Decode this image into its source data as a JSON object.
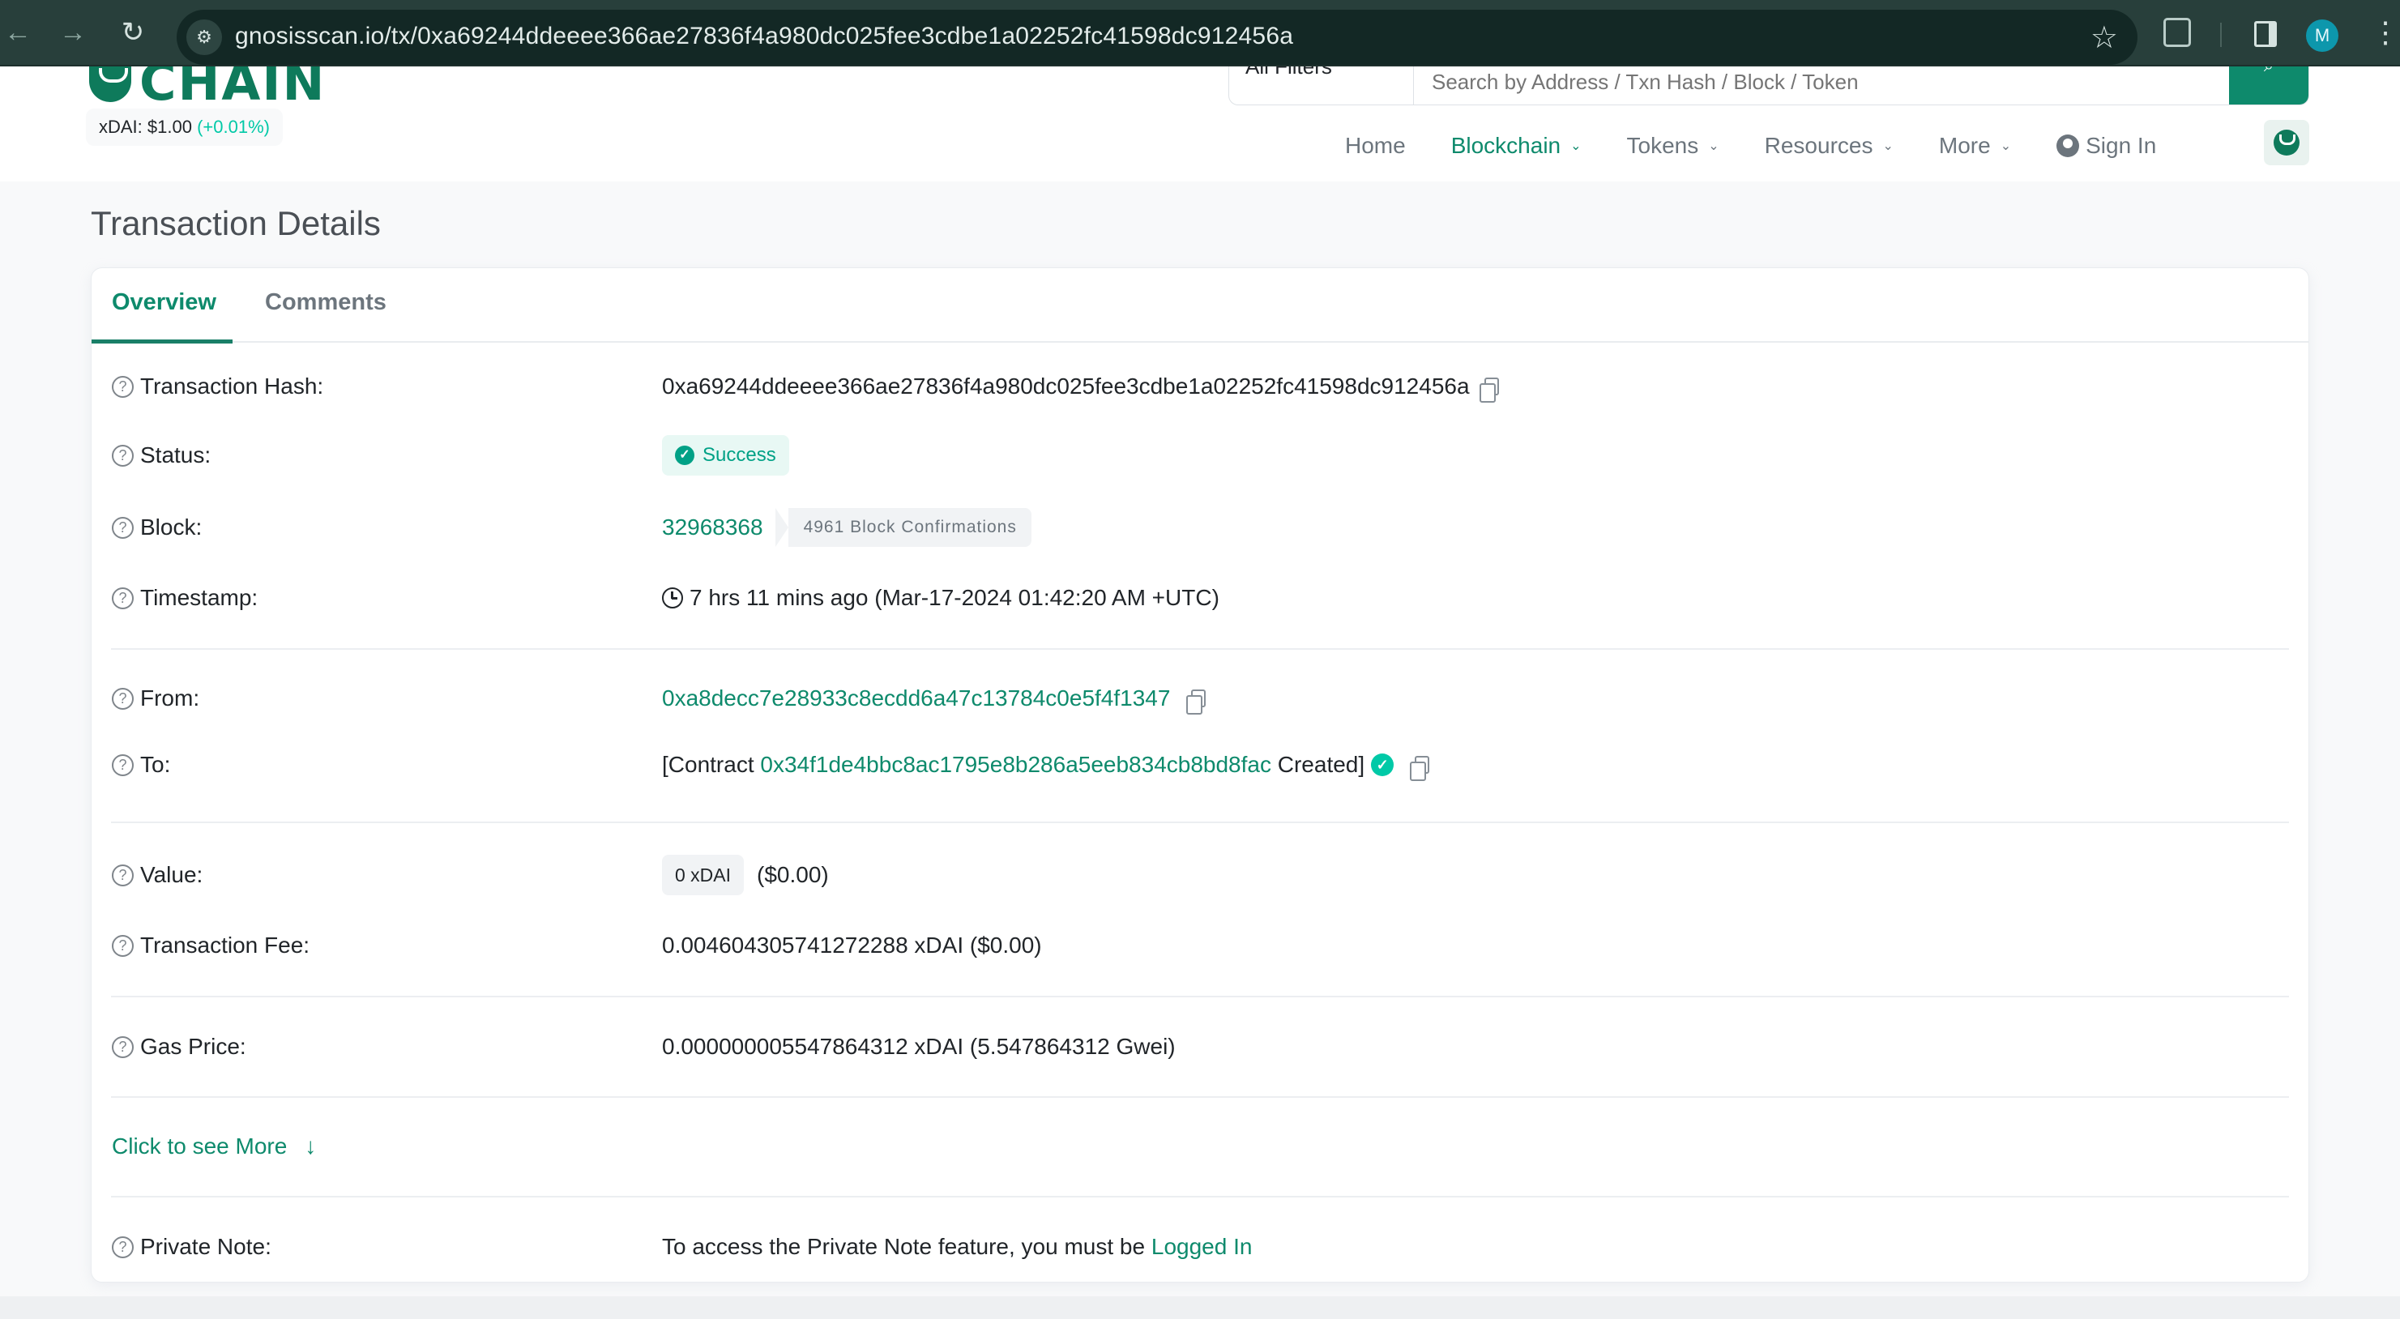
{
  "browser": {
    "url": "gnosisscan.io/tx/0xa69244ddeeee366ae27836f4a980dc025fee3cdbe1a02252fc41598dc912456a",
    "profile_initial": "M",
    "icons": {
      "back": "arrow-left-icon",
      "forward": "arrow-right-icon",
      "reload": "reload-icon",
      "site_info": "tune-icon",
      "bookmark": "star-icon",
      "extensions": "puzzle-icon",
      "side_panel": "side-panel-icon",
      "menu": "kebab-menu-icon"
    }
  },
  "header": {
    "logo_text": "CHAIN",
    "price": {
      "label": "xDAI: $1.00",
      "change": "(+0.01%)"
    },
    "search": {
      "filter_label": "All Filters",
      "placeholder": "Search by Address / Txn Hash / Block / Token",
      "button_icon": "search-icon"
    },
    "nav": [
      {
        "label": "Home",
        "active": false,
        "has_caret": false
      },
      {
        "label": "Blockchain",
        "active": true,
        "has_caret": true
      },
      {
        "label": "Tokens",
        "active": false,
        "has_caret": true
      },
      {
        "label": "Resources",
        "active": false,
        "has_caret": true
      },
      {
        "label": "More",
        "active": false,
        "has_caret": true
      }
    ],
    "sign_in": "Sign In"
  },
  "page": {
    "title": "Transaction Details",
    "tabs": [
      {
        "label": "Overview",
        "active": true
      },
      {
        "label": "Comments",
        "active": false
      }
    ]
  },
  "details": {
    "tx_hash": {
      "label": "Transaction Hash:",
      "value": "0xa69244ddeeee366ae27836f4a980dc025fee3cdbe1a02252fc41598dc912456a"
    },
    "status": {
      "label": "Status:",
      "value": "Success"
    },
    "block": {
      "label": "Block:",
      "number": "32968368",
      "confirmations": "4961 Block Confirmations"
    },
    "timestamp": {
      "label": "Timestamp:",
      "value": "7 hrs 11 mins ago (Mar-17-2024 01:42:20 AM +UTC)"
    },
    "from": {
      "label": "From:",
      "address": "0xa8decc7e28933c8ecdd6a47c13784c0e5f4f1347"
    },
    "to": {
      "label": "To:",
      "prefix": "[Contract",
      "address": "0x34f1de4bbc8ac1795e8b286a5eeb834cb8bd8fac",
      "suffix": "Created]"
    },
    "value": {
      "label": "Value:",
      "amount": "0 xDAI",
      "usd": "($0.00)"
    },
    "fee": {
      "label": "Transaction Fee:",
      "value": "0.004604305741272288 xDAI ($0.00)"
    },
    "gas_price": {
      "label": "Gas Price:",
      "value": "0.000000005547864312 xDAI (5.547864312 Gwei)"
    },
    "see_more": "Click to see More",
    "private_note": {
      "label": "Private Note:",
      "text": "To access the Private Note feature, you must be",
      "link": "Logged In"
    }
  },
  "colors": {
    "brand": "#0e8a6c",
    "success": "#00a186",
    "price_up": "#00c9a7",
    "chrome_bg": "#283f3b"
  }
}
